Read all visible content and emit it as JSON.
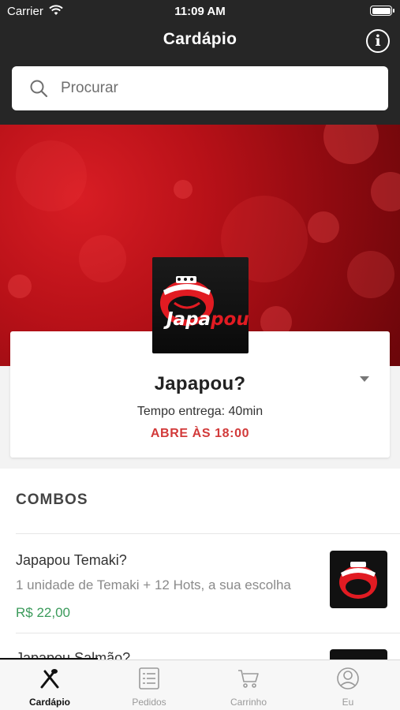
{
  "status_bar": {
    "carrier": "Carrier",
    "time": "11:09 AM"
  },
  "header": {
    "title": "Cardápio",
    "info_icon": "info-icon"
  },
  "search": {
    "placeholder": "Procurar"
  },
  "store": {
    "name": "Japapou?",
    "delivery_time": "Tempo entrega: 40min",
    "opening_status": "ABRE ÀS 18:00",
    "logo_text": "Japapou?"
  },
  "menu": {
    "section_title": "COMBOS",
    "items": [
      {
        "name": "Japapou Temaki?",
        "description": "1 unidade de Temaki + 12 Hots, a sua escolha",
        "price": "R$ 22,00"
      },
      {
        "name": "Japapou Salmão?"
      }
    ]
  },
  "tabbar": {
    "tabs": [
      {
        "label": "Cardápio",
        "icon": "fork-knife-icon",
        "active": true
      },
      {
        "label": "Pedidos",
        "icon": "list-icon",
        "active": false
      },
      {
        "label": "Carrinho",
        "icon": "cart-icon",
        "active": false
      },
      {
        "label": "Eu",
        "icon": "user-icon",
        "active": false
      }
    ]
  },
  "colors": {
    "header_bg": "#262626",
    "banner_red": "#b81118",
    "accent_red": "#d23a3a",
    "price_green": "#3a9a5a"
  }
}
